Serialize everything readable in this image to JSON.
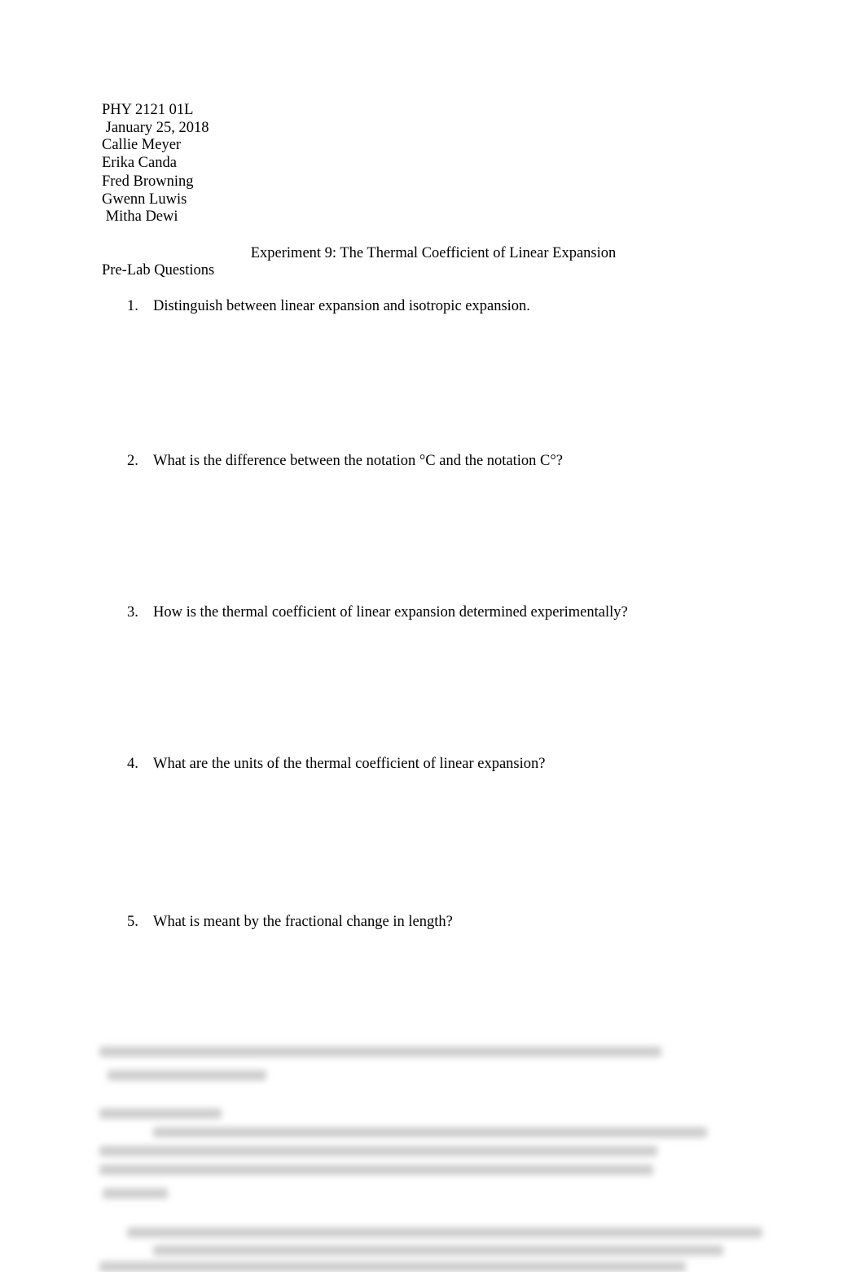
{
  "header": {
    "course": "PHY 2121 01L",
    "date": " January 25, 2018",
    "authors": [
      "Callie Meyer",
      "Erika Canda",
      "Fred Browning",
      "Gwenn Luwis",
      " Mitha Dewi"
    ]
  },
  "document": {
    "title": "Experiment 9: The Thermal Coefficient of Linear Expansion",
    "section_heading": "Pre-Lab Questions",
    "questions": [
      {
        "number": "1.",
        "text": "Distinguish between linear expansion and isotropic expansion."
      },
      {
        "number": "2.",
        "text": "What is the difference between the notation °C and the notation C°?"
      },
      {
        "number": "3.",
        "text": "How is the thermal coefficient of linear expansion determined experimentally?"
      },
      {
        "number": "4.",
        "text": "What are the units of the thermal coefficient of linear expansion?"
      },
      {
        "number": "5.",
        "text": "What is meant by the fractional change in length?"
      }
    ]
  },
  "obscured_preview": {
    "state": "blurred",
    "legible_text": ""
  }
}
